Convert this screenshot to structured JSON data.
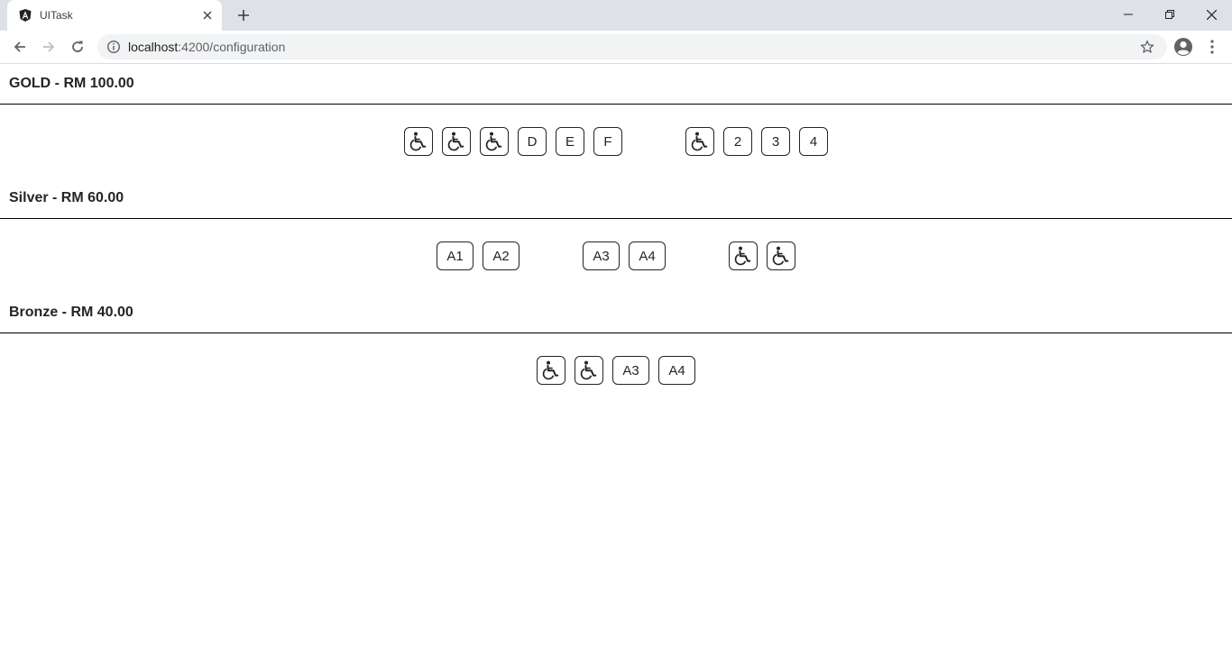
{
  "browser": {
    "tab_title": "UITask",
    "url_host": "localhost",
    "url_path": ":4200/configuration"
  },
  "sections": [
    {
      "title": "GOLD - RM 100.00",
      "groups": [
        [
          {
            "type": "wheelchair",
            "icon": "wheelchair-icon"
          },
          {
            "type": "wheelchair",
            "icon": "wheelchair-icon"
          },
          {
            "type": "wheelchair",
            "icon": "wheelchair-icon"
          },
          {
            "type": "seat",
            "label": "D"
          },
          {
            "type": "seat",
            "label": "E"
          },
          {
            "type": "seat",
            "label": "F"
          }
        ],
        [
          {
            "type": "wheelchair",
            "icon": "wheelchair-icon"
          },
          {
            "type": "seat",
            "label": "2"
          },
          {
            "type": "seat",
            "label": "3"
          },
          {
            "type": "seat",
            "label": "4"
          }
        ]
      ]
    },
    {
      "title": "Silver - RM 60.00",
      "groups": [
        [
          {
            "type": "seat",
            "label": "A1"
          },
          {
            "type": "seat",
            "label": "A2"
          }
        ],
        [
          {
            "type": "seat",
            "label": "A3"
          },
          {
            "type": "seat",
            "label": "A4"
          }
        ],
        [
          {
            "type": "wheelchair",
            "icon": "wheelchair-icon"
          },
          {
            "type": "wheelchair",
            "icon": "wheelchair-icon"
          }
        ]
      ]
    },
    {
      "title": "Bronze - RM 40.00",
      "groups": [
        [
          {
            "type": "wheelchair",
            "icon": "wheelchair-icon"
          },
          {
            "type": "wheelchair",
            "icon": "wheelchair-icon"
          },
          {
            "type": "seat",
            "label": "A3"
          },
          {
            "type": "seat",
            "label": "A4"
          }
        ]
      ]
    }
  ]
}
